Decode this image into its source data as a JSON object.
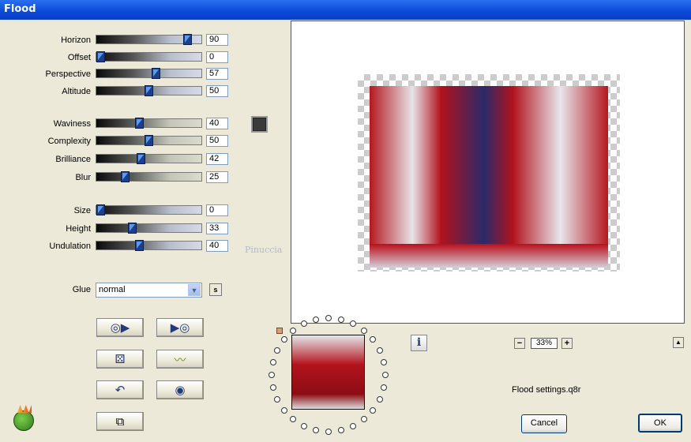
{
  "window": {
    "title": "Flood"
  },
  "sliders": [
    {
      "label": "Horizon",
      "value": "90",
      "fraction": 0.9,
      "tone": "blue"
    },
    {
      "label": "Offset",
      "value": "0",
      "fraction": 0.0,
      "tone": "blue"
    },
    {
      "label": "Perspective",
      "value": "57",
      "fraction": 0.57,
      "tone": "blue"
    },
    {
      "label": "Altitude",
      "value": "50",
      "fraction": 0.5,
      "tone": "blue"
    },
    {
      "label": "Waviness",
      "value": "40",
      "fraction": 0.4,
      "tone": "olive"
    },
    {
      "label": "Complexity",
      "value": "50",
      "fraction": 0.5,
      "tone": "olive"
    },
    {
      "label": "Brilliance",
      "value": "42",
      "fraction": 0.42,
      "tone": "olive"
    },
    {
      "label": "Blur",
      "value": "25",
      "fraction": 0.25,
      "tone": "olive"
    },
    {
      "label": "Size",
      "value": "0",
      "fraction": 0.0,
      "tone": "blue"
    },
    {
      "label": "Height",
      "value": "33",
      "fraction": 0.33,
      "tone": "blue"
    },
    {
      "label": "Undulation",
      "value": "40",
      "fraction": 0.4,
      "tone": "blue"
    }
  ],
  "color_swatch": "#3a3a3a",
  "glue": {
    "label": "Glue",
    "selected": "normal",
    "s_button": "s"
  },
  "zoom": {
    "level": "33%",
    "minus": "−",
    "plus": "+"
  },
  "settings_file": "Flood settings.q8r",
  "buttons": {
    "cancel": "Cancel",
    "ok": "OK",
    "info": "i",
    "up": "▲"
  },
  "watermark": "Pinuccia"
}
